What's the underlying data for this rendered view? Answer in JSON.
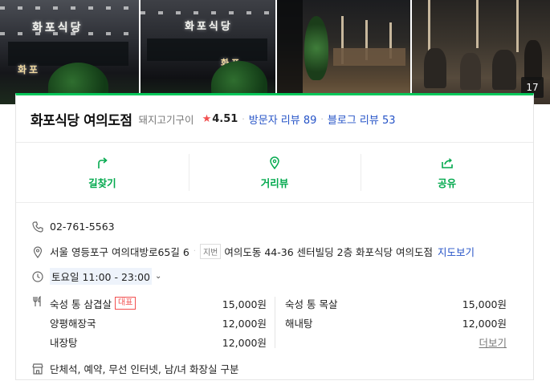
{
  "photos": {
    "count": "17"
  },
  "place": {
    "name": "화포식당 여의도점",
    "category": "돼지고기구이",
    "rating": "4.51",
    "visitor_review": "방문자 리뷰 89",
    "blog_review": "블로그 리뷰 53"
  },
  "actions": [
    {
      "label": "길찾기",
      "icon": "directions-icon"
    },
    {
      "label": "거리뷰",
      "icon": "street-view-icon"
    },
    {
      "label": "공유",
      "icon": "share-icon"
    }
  ],
  "info": {
    "phone": "02-761-5563",
    "address": "서울 영등포구 여의대방로65길 6",
    "jibeon_label": "지번",
    "jibeon_address": "여의도동 44-36 센터빌딩 2층 화포식당 여의도점",
    "map_link": "지도보기",
    "hours": "토요일 11:00 - 23:00",
    "facilities": "단체석, 예약, 무선 인터넷, 남/녀 화장실 구분"
  },
  "menu": {
    "left": [
      {
        "name": "숙성 통 삼겹살",
        "badge": "대표",
        "price": "15,000원"
      },
      {
        "name": "양평해장국",
        "price": "12,000원"
      },
      {
        "name": "내장탕",
        "price": "12,000원"
      }
    ],
    "right": [
      {
        "name": "숙성 통 목살",
        "price": "15,000원"
      },
      {
        "name": "해내탕",
        "price": "12,000원"
      }
    ],
    "more": "더보기"
  },
  "colors": {
    "accent": "#03c75a",
    "link": "#2553c7",
    "star": "#f25050"
  }
}
